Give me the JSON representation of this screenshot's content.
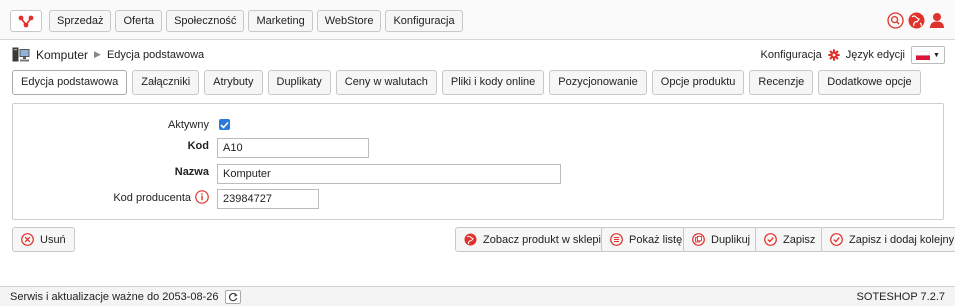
{
  "topbar": {
    "logo_icon": "soteshop-logo-icon",
    "nav": [
      "Sprzedaż",
      "Oferta",
      "Społeczność",
      "Marketing",
      "WebStore",
      "Konfiguracja"
    ],
    "icons": [
      "search-icon",
      "globe-icon",
      "user-icon"
    ],
    "accent_color": "#e0322b"
  },
  "breadcrumb": {
    "root": "Komputer",
    "current": "Edycja podstawowa",
    "config_label": "Konfiguracja",
    "lang_label": "Język edycji"
  },
  "tabs": [
    "Edycja podstawowa",
    "Załączniki",
    "Atrybuty",
    "Duplikaty",
    "Ceny w walutach",
    "Pliki i kody online",
    "Pozycjonowanie",
    "Opcje produktu",
    "Recenzje",
    "Dodatkowe opcje"
  ],
  "form": {
    "active_label": "Aktywny",
    "active_checked": true,
    "kod_label": "Kod",
    "kod_value": "A10",
    "nazwa_label": "Nazwa",
    "nazwa_value": "Komputer",
    "producer_code_label": "Kod producenta",
    "producer_code_value": "23984727"
  },
  "actions": {
    "delete": "Usuń",
    "view_in_store": "Zobacz produkt w sklepie",
    "show_list": "Pokaż listę",
    "duplicate": "Duplikuj",
    "save": "Zapisz",
    "save_and_add": "Zapisz i dodaj kolejny"
  },
  "footer": {
    "service_text": "Serwis i aktualizacje ważne do 2053-08-26",
    "version": "SOTESHOP 7.2.7"
  }
}
